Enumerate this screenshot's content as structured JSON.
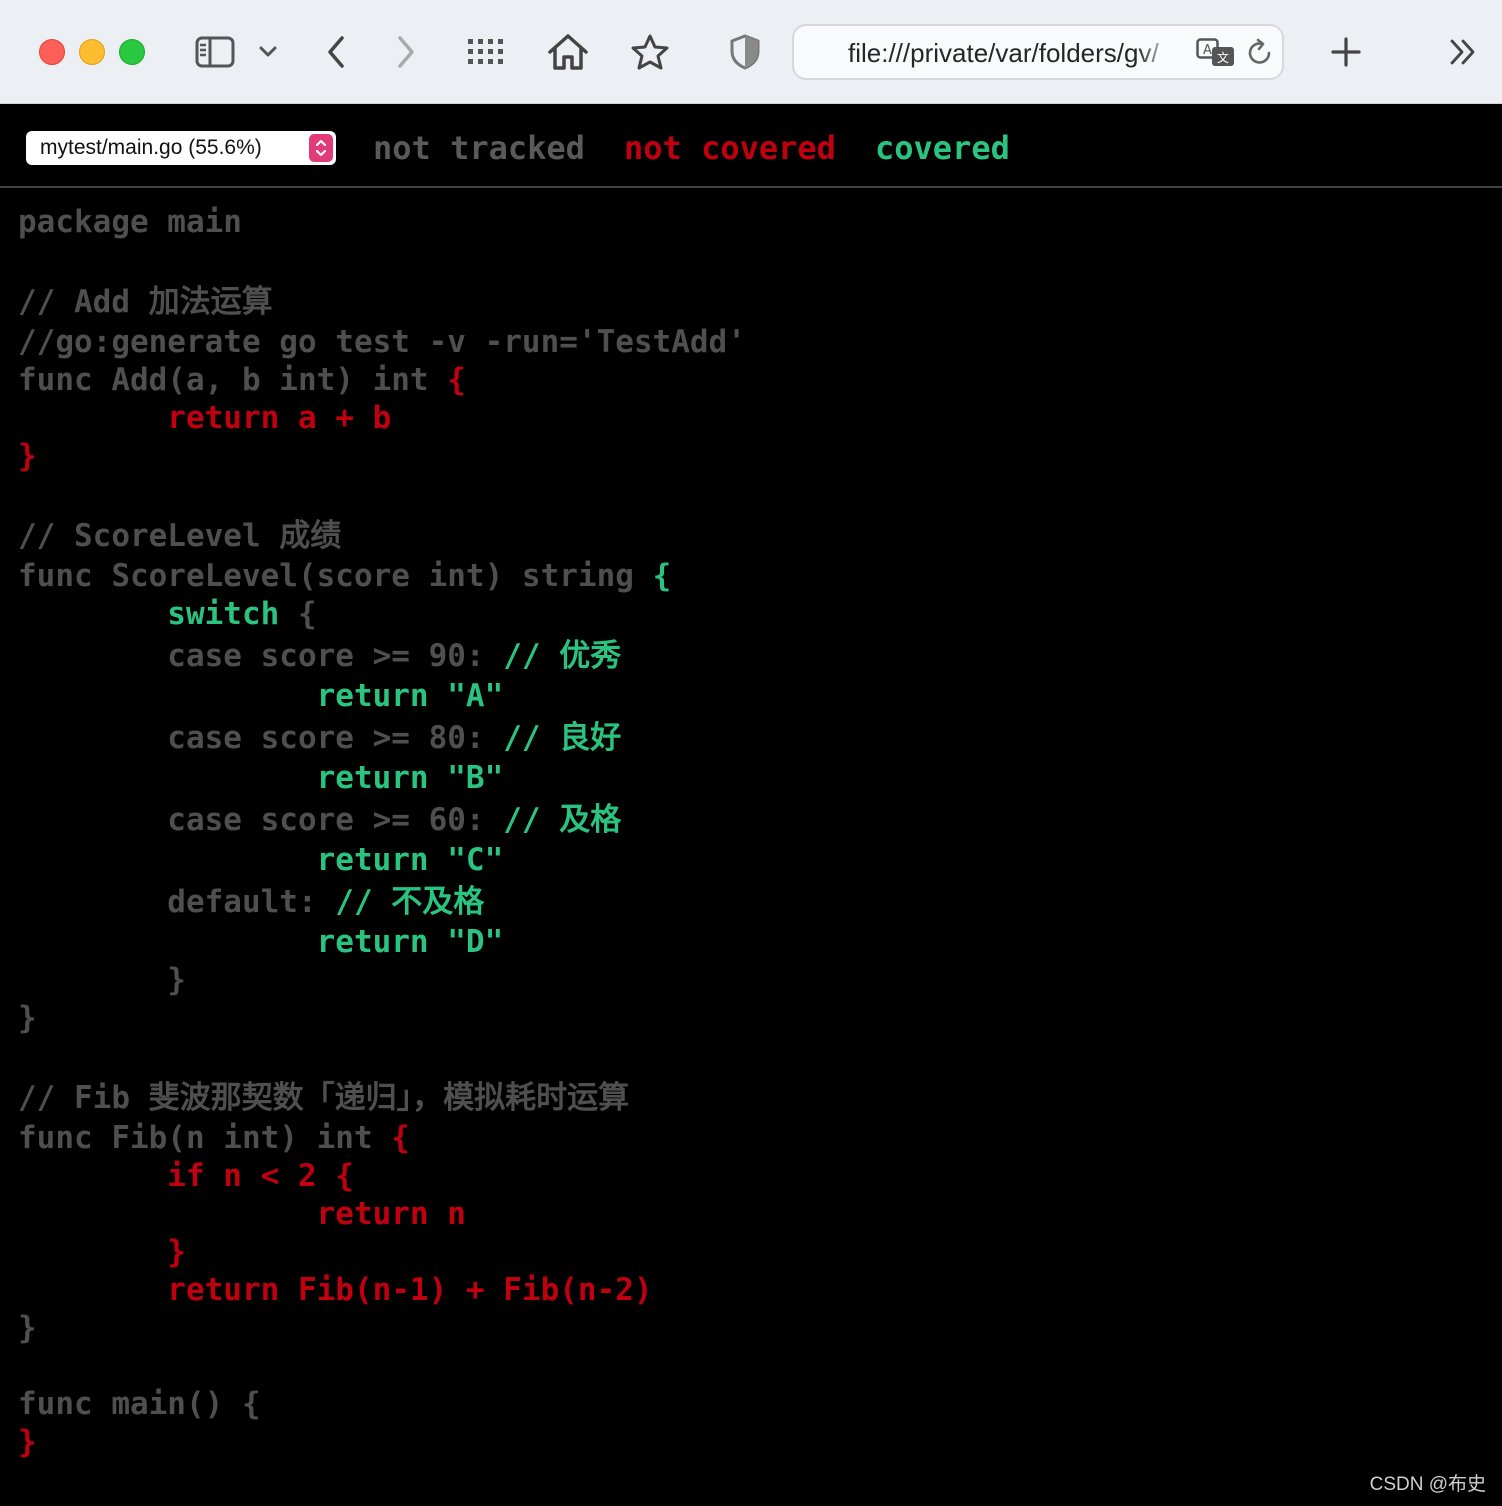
{
  "browser": {
    "url": "file:///private/var/folders/gv/",
    "icons": [
      "sidebar-icon",
      "chevron-down-icon",
      "back-icon",
      "forward-icon",
      "grid-icon",
      "home-icon",
      "star-icon",
      "shield-icon",
      "translate-icon",
      "reload-icon",
      "plus-icon",
      "double-chevron-icon"
    ]
  },
  "coverage": {
    "file_select": "mytest/main.go (55.6%)",
    "legend": {
      "not_tracked": "not tracked",
      "not_covered": "not covered",
      "covered": "covered"
    },
    "colors": {
      "not_tracked": "#4f4f4f",
      "not_covered": "#c0000f",
      "covered": "#2bc380"
    }
  },
  "code": {
    "lines": [
      {
        "segments": [
          {
            "cls": "nt",
            "text": "package main"
          }
        ]
      },
      {
        "segments": [
          {
            "cls": "nt",
            "text": "// Add 加法运算"
          }
        ]
      },
      {
        "segments": [
          {
            "cls": "nt",
            "text": "//go:generate go test -v -run='TestAdd'"
          }
        ]
      },
      {
        "segments": [
          {
            "cls": "nt",
            "text": "func Add(a, b int) int "
          },
          {
            "cls": "nc",
            "text": "{"
          }
        ]
      },
      {
        "segments": [
          {
            "cls": "nc",
            "text": "        return a + b"
          }
        ]
      },
      {
        "segments": [
          {
            "cls": "nc",
            "text": "}"
          }
        ]
      },
      {
        "segments": [
          {
            "cls": "nt",
            "text": "// ScoreLevel 成绩"
          }
        ]
      },
      {
        "segments": [
          {
            "cls": "nt",
            "text": "func ScoreLevel(score int) string "
          },
          {
            "cls": "cv",
            "text": "{"
          }
        ]
      },
      {
        "segments": [
          {
            "cls": "cv",
            "text": "        switch"
          },
          {
            "cls": "nt",
            "text": " {"
          }
        ]
      },
      {
        "segments": [
          {
            "cls": "nt",
            "text": "        case score >= 90: "
          },
          {
            "cls": "cv",
            "text": "// 优秀"
          }
        ]
      },
      {
        "segments": [
          {
            "cls": "cv",
            "text": "                return \"A\""
          }
        ]
      },
      {
        "segments": [
          {
            "cls": "nt",
            "text": "        case score >= 80: "
          },
          {
            "cls": "cv",
            "text": "// 良好"
          }
        ]
      },
      {
        "segments": [
          {
            "cls": "cv",
            "text": "                return \"B\""
          }
        ]
      },
      {
        "segments": [
          {
            "cls": "nt",
            "text": "        case score >= 60: "
          },
          {
            "cls": "cv",
            "text": "// 及格"
          }
        ]
      },
      {
        "segments": [
          {
            "cls": "cv",
            "text": "                return \"C\""
          }
        ]
      },
      {
        "segments": [
          {
            "cls": "nt",
            "text": "        default: "
          },
          {
            "cls": "cv",
            "text": "// 不及格"
          }
        ]
      },
      {
        "segments": [
          {
            "cls": "cv",
            "text": "                return \"D\""
          }
        ]
      },
      {
        "segments": [
          {
            "cls": "nt",
            "text": "        }"
          }
        ]
      },
      {
        "segments": [
          {
            "cls": "nt",
            "text": "}"
          }
        ]
      },
      {
        "segments": [
          {
            "cls": "nt",
            "text": "// Fib 斐波那契数「递归」，模拟耗时运算"
          }
        ]
      },
      {
        "segments": [
          {
            "cls": "nt",
            "text": "func Fib(n int) int "
          },
          {
            "cls": "nc",
            "text": "{"
          }
        ]
      },
      {
        "segments": [
          {
            "cls": "nc",
            "text": "        if n < 2 {"
          }
        ]
      },
      {
        "segments": [
          {
            "cls": "nc",
            "text": "                return n"
          }
        ]
      },
      {
        "segments": [
          {
            "cls": "nc",
            "text": "        }"
          }
        ]
      },
      {
        "segments": [
          {
            "cls": "nc",
            "text": "        return Fib(n-1) + Fib(n-2)"
          }
        ]
      },
      {
        "segments": [
          {
            "cls": "nt",
            "text": "}"
          }
        ]
      },
      {
        "segments": [
          {
            "cls": "nt",
            "text": "func main() {"
          }
        ]
      },
      {
        "segments": [
          {
            "cls": "nc",
            "text": "}"
          }
        ]
      }
    ]
  },
  "watermark": "CSDN @布史"
}
